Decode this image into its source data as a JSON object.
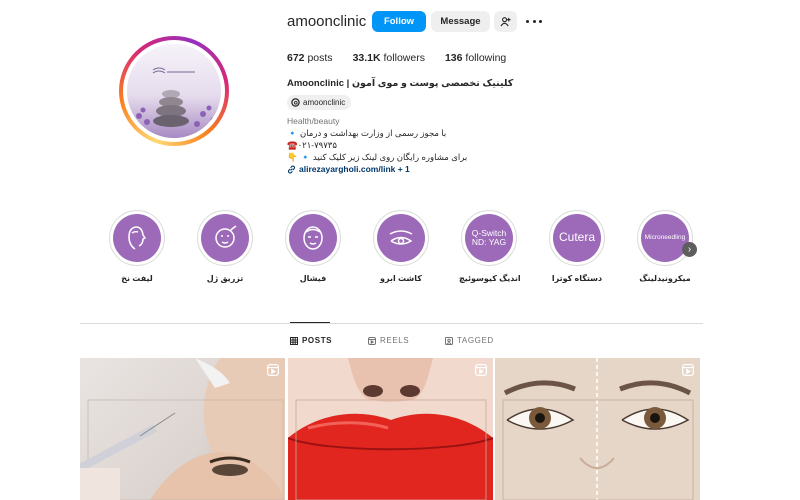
{
  "profile": {
    "username": "amoonclinic",
    "follow_label": "Follow",
    "message_label": "Message",
    "posts_count": "672",
    "posts_label": "posts",
    "followers_count": "33.1K",
    "followers_label": "followers",
    "following_count": "136",
    "following_label": "following",
    "full_name": "Amoonclinic | کلینیک تخصصی پوست و موی آمون",
    "threads_handle": "amoonclinic",
    "category": "Health/beauty",
    "bio_line1": "🔹 با مجوز رسمی از وزارت بهداشت و درمان",
    "bio_line2": "☎️۰۲۱-۷۹۷۳۵",
    "bio_line3": "👇 🔹 برای مشاوره رایگان روی لینک زیر کلیک کنید",
    "link_text": "alirezayargholi.com/link + 1"
  },
  "highlights": [
    {
      "label": "لیفت نخ",
      "icon": "face-lift-icon",
      "text": ""
    },
    {
      "label": "تزریق ژل",
      "icon": "gel-injection-icon",
      "text": ""
    },
    {
      "label": "فیشال",
      "icon": "facial-mask-icon",
      "text": ""
    },
    {
      "label": "کاشت ابرو",
      "icon": "eyebrow-icon",
      "text": ""
    },
    {
      "label": "اندیگ کیوسوئیچ",
      "icon": "laser-icon",
      "text": "Q-Switch ND: YAG"
    },
    {
      "label": "دستگاه کوترا",
      "icon": "cutera-icon",
      "text": "Cutera"
    },
    {
      "label": "میکرونیدلینگ",
      "icon": "microneedling-icon",
      "text": "Microneedling"
    }
  ],
  "tabs": [
    {
      "label": "POSTS",
      "icon": "grid-icon"
    },
    {
      "label": "REELS",
      "icon": "reels-icon"
    },
    {
      "label": "TAGGED",
      "icon": "tagged-icon"
    }
  ],
  "colors": {
    "accent": "#0095f6",
    "highlight_purple": "#9c6ab8",
    "link": "#00376b"
  }
}
